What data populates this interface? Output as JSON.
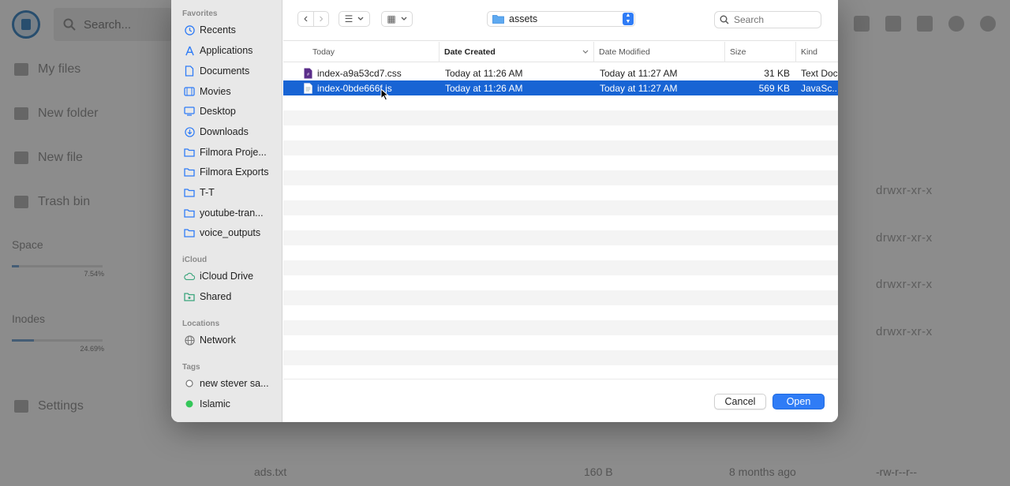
{
  "background_app": {
    "search_placeholder": "Search...",
    "nav": [
      {
        "label": "My files",
        "icon": "folder-icon"
      },
      {
        "label": "New folder",
        "icon": "folder-plus-icon"
      },
      {
        "label": "New file",
        "icon": "file-plus-icon"
      },
      {
        "label": "Trash bin",
        "icon": "trash-icon"
      }
    ],
    "space_label": "Space",
    "space_pct": "7.54%",
    "space_fraction": 0.0754,
    "inodes_label": "Inodes",
    "inodes_pct": "24.69%",
    "inodes_fraction": 0.2469,
    "settings_label": "Settings",
    "permissions": [
      "drwxr-xr-x",
      "drwxr-xr-x",
      "drwxr-xr-x",
      "drwxr-xr-x"
    ],
    "bottom_file": {
      "name": "ads.txt",
      "size": "160 B",
      "modified": "8 months ago",
      "perm": "-rw-r--r--"
    }
  },
  "dialog": {
    "sidebar": {
      "favorites_heading": "Favorites",
      "favorites": [
        {
          "label": "Recents",
          "icon": "clock-icon"
        },
        {
          "label": "Applications",
          "icon": "applications-icon"
        },
        {
          "label": "Documents",
          "icon": "document-icon"
        },
        {
          "label": "Movies",
          "icon": "film-icon"
        },
        {
          "label": "Desktop",
          "icon": "desktop-icon"
        },
        {
          "label": "Downloads",
          "icon": "download-icon"
        },
        {
          "label": "Filmora Proje...",
          "icon": "folder-icon"
        },
        {
          "label": "Filmora Exports",
          "icon": "folder-icon"
        },
        {
          "label": "T-T",
          "icon": "folder-icon"
        },
        {
          "label": "youtube-tran...",
          "icon": "folder-icon"
        },
        {
          "label": "voice_outputs",
          "icon": "folder-icon"
        }
      ],
      "icloud_heading": "iCloud",
      "icloud": [
        {
          "label": "iCloud Drive",
          "icon": "cloud-icon"
        },
        {
          "label": "Shared",
          "icon": "shared-folder-icon"
        }
      ],
      "locations_heading": "Locations",
      "locations": [
        {
          "label": "Network",
          "icon": "globe-icon"
        }
      ],
      "tags_heading": "Tags",
      "tags": [
        {
          "label": "new stever sa...",
          "color": "#ffffff"
        },
        {
          "label": "Islamic",
          "color": "#34c759"
        }
      ]
    },
    "toolbar": {
      "back_glyph": "‹",
      "forward_glyph": "›",
      "list_view_glyph": "☰",
      "grid_view_glyph": "▦",
      "location": "assets",
      "search_placeholder": "Search"
    },
    "columns": {
      "name": "Today",
      "date_created": "Date Created",
      "date_modified": "Date Modified",
      "size": "Size",
      "kind": "Kind"
    },
    "files": [
      {
        "name": "index-a9a53cd7.css",
        "date_created": "Today at 11:26 AM",
        "date_modified": "Today at 11:27 AM",
        "size": "31 KB",
        "kind": "Text Doc",
        "selected": false,
        "icon_color": "#5a2d8a"
      },
      {
        "name": "index-0bde666f.js",
        "date_created": "Today at 11:26 AM",
        "date_modified": "Today at 11:27 AM",
        "size": "569 KB",
        "kind": "JavaSc...",
        "selected": true,
        "icon_color": "#ffffff"
      }
    ],
    "buttons": {
      "cancel": "Cancel",
      "open": "Open"
    },
    "accent_color": "#2f7cf6",
    "selection_color": "#1864d4"
  }
}
